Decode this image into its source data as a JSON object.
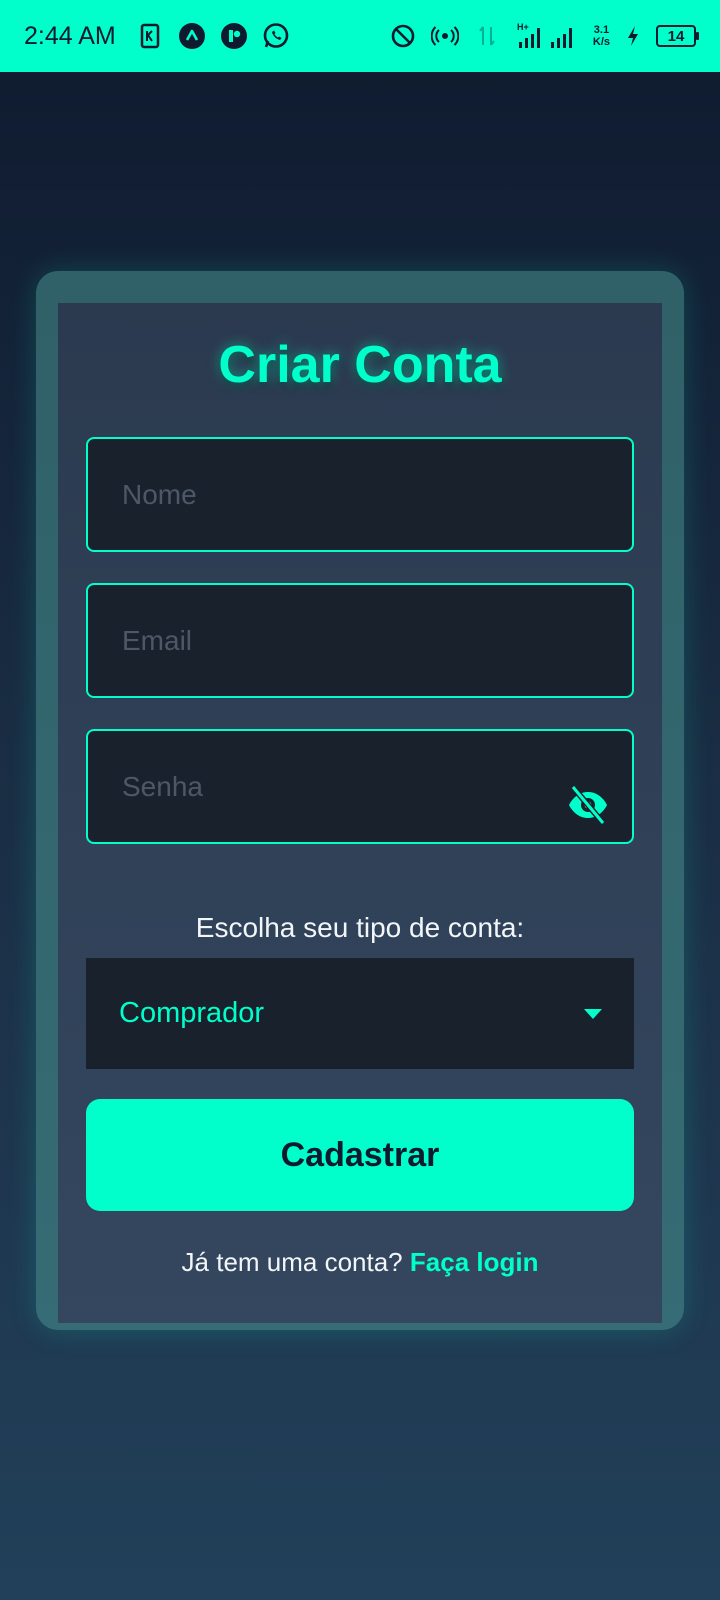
{
  "status_bar": {
    "time": "2:44 AM",
    "speed_value": "3.1",
    "speed_unit": "K/s",
    "battery": "14",
    "network_type": "H+",
    "icons": [
      "k-app-icon",
      "triangle-app-icon",
      "r-app-icon",
      "whatsapp-icon",
      "blocked-icon",
      "hotspot-icon",
      "data-arrows-icon",
      "signal-icon",
      "charging-icon"
    ]
  },
  "form": {
    "title": "Criar Conta",
    "name_placeholder": "Nome",
    "email_placeholder": "Email",
    "password_placeholder": "Senha",
    "account_type_label": "Escolha seu tipo de conta:",
    "account_type_selected": "Comprador",
    "submit_label": "Cadastrar",
    "login_prompt": "Já tem uma conta?",
    "login_link": "Faça login"
  },
  "colors": {
    "accent": "#00ffcb",
    "card": "#2f4057",
    "input_bg": "#19212d",
    "background_top": "#0f1a2e",
    "background_bottom": "#22405a"
  }
}
